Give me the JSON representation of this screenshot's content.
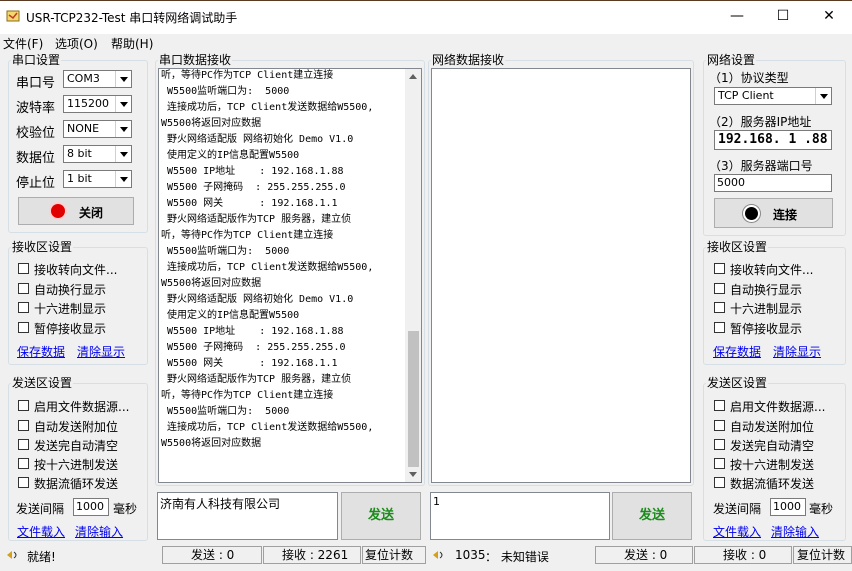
{
  "window": {
    "title": "USR-TCP232-Test 串口转网络调试助手",
    "minimize": "—",
    "maximize": "☐",
    "close": "✕"
  },
  "menu": [
    "文件(F)",
    "选项(O)",
    "帮助(H)"
  ],
  "serial_settings": {
    "title": "串口设置",
    "port_label": "串口号",
    "port_value": "COM3",
    "baud_label": "波特率",
    "baud_value": "115200",
    "parity_label": "校验位",
    "parity_value": "NONE",
    "databits_label": "数据位",
    "databits_value": "8 bit",
    "stopbits_label": "停止位",
    "stopbits_value": "1 bit",
    "close_button": "关闭"
  },
  "serial_receive": {
    "title": "串口数据接收",
    "lines": [
      "听，等待PC作为TCP Client建立连接",
      " W5500监听端口为:  5000",
      " 连接成功后，TCP Client发送数据给W5500,",
      "W5500将返回对应数据",
      " 野火网络适配版 网络初始化 Demo V1.0",
      " 使用定义的IP信息配置W5500",
      " W5500 IP地址    : 192.168.1.88",
      " W5500 子网掩码  : 255.255.255.0",
      " W5500 网关      : 192.168.1.1",
      " 野火网络适配版作为TCP 服务器，建立侦",
      "听，等待PC作为TCP Client建立连接",
      " W5500监听端口为:  5000",
      " 连接成功后，TCP Client发送数据给W5500,",
      "W5500将返回对应数据",
      " 野火网络适配版 网络初始化 Demo V1.0",
      " 使用定义的IP信息配置W5500",
      " W5500 IP地址    : 192.168.1.88",
      " W5500 子网掩码  : 255.255.255.0",
      " W5500 网关      : 192.168.1.1",
      " 野火网络适配版作为TCP 服务器，建立侦",
      "听，等待PC作为TCP Client建立连接",
      " W5500监听端口为:  5000",
      " 连接成功后，TCP Client发送数据给W5500,",
      "W5500将返回对应数据"
    ]
  },
  "network_receive": {
    "title": "网络数据接收"
  },
  "left_receive_settings": {
    "title": "接收区设置",
    "options": [
      "接收转向文件...",
      "自动换行显示",
      "十六进制显示",
      "暂停接收显示"
    ],
    "save_link": "保存数据",
    "clear_link": "清除显示"
  },
  "left_send_settings": {
    "title": "发送区设置",
    "options": [
      "启用文件数据源...",
      "自动发送附加位",
      "发送完自动清空",
      "按十六进制发送",
      "数据流循环发送"
    ],
    "interval_label": "发送间隔",
    "interval_value": "1000",
    "interval_unit": "毫秒",
    "load_link": "文件载入",
    "clear_link": "清除输入"
  },
  "right_net_settings": {
    "title": "网络设置",
    "protocol_label": "（1）协议类型",
    "protocol_value": "TCP Client",
    "ip_label": "（2）服务器IP地址",
    "ip_value": "192.168. 1 .88",
    "port_label": "（3）服务器端口号",
    "port_value": "5000",
    "connect_button": "连接"
  },
  "right_receive_settings": {
    "title": "接收区设置",
    "options": [
      "接收转向文件...",
      "自动换行显示",
      "十六进制显示",
      "暂停接收显示"
    ],
    "save_link": "保存数据",
    "clear_link": "清除显示"
  },
  "right_send_settings": {
    "title": "发送区设置",
    "options": [
      "启用文件数据源...",
      "自动发送附加位",
      "发送完自动清空",
      "按十六进制发送",
      "数据流循环发送"
    ],
    "interval_label": "发送间隔",
    "interval_value": "1000",
    "interval_unit": "毫秒",
    "load_link": "文件载入",
    "clear_link": "清除输入"
  },
  "serial_send": {
    "text": "济南有人科技有限公司",
    "button": "发送"
  },
  "network_send": {
    "text": "1",
    "button": "发送"
  },
  "status_left": {
    "ready": "就绪!",
    "sent": "发送 : 0",
    "received": "接收 : 2261",
    "reset": "复位计数"
  },
  "status_right": {
    "error_code": "1035",
    "error_text": "：  未知错误",
    "sent": "发送 : 0",
    "received": "接收 : 0",
    "reset": "复位计数"
  },
  "colors": {
    "title_border": "#5a3a20",
    "link": "#0000ee",
    "send_button_text": "#1a8c1a",
    "record_red": "#e00000"
  }
}
